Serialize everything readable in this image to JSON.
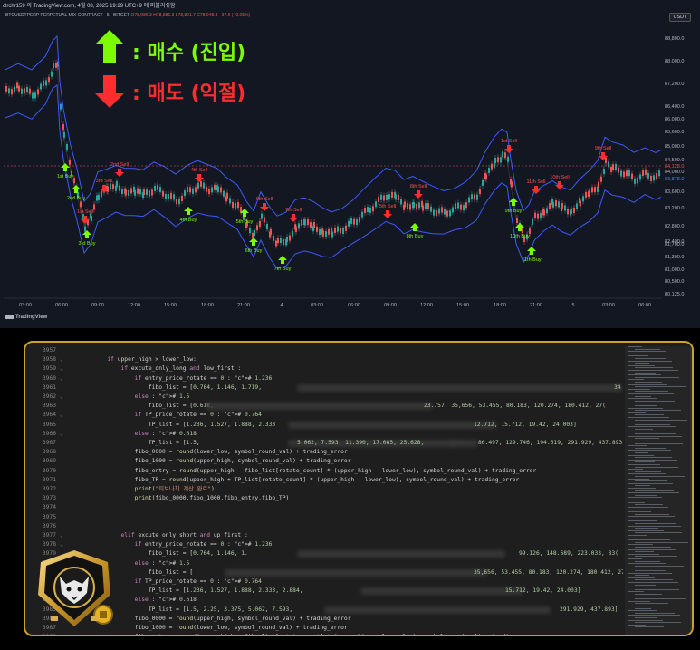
{
  "tv": {
    "header": "clrchr159 의 TradingView.com, 4월 08, 2025 19:29 UTC+9 에 퍼블리쉬함",
    "title": "BTCUSDTPERP PERPETUAL MIX CONTRACT · 5 · BITGET",
    "ohlc": "O78,986.3 H78,986.3 L78,891.7 C78,948.3 −37.9 (−0.05%)",
    "currency": "USDT",
    "legend_buy": ": 매수 (진입)",
    "legend_sell": ": 매도 (익절)",
    "footer": "TradingView",
    "colors": {
      "buy": "#7cfc00",
      "sell": "#ff2d2d",
      "band": "#3d5afe",
      "bg": "#131722"
    },
    "y_ticks": [
      "88,800.0",
      "88,000.0",
      "87,200.0",
      "86,400.0",
      "86,000.0",
      "85,600.0",
      "85,000.0",
      "84,500.0",
      "84,128.0",
      "84,000.0",
      "83,878.0",
      "83,600.0",
      "83,200.0",
      "82,800.0",
      "82,400.0",
      "81,700.0",
      "81,300.0",
      "81,000.0",
      "80,500.0",
      "80,125.0"
    ],
    "x_ticks": [
      "03:00",
      "06:00",
      "09:00",
      "12:00",
      "15:00",
      "18:00",
      "21:00",
      "4",
      "03:00",
      "06:00",
      "09:00",
      "12:00",
      "15:00",
      "18:00",
      "21:00",
      "5",
      "03:00",
      "06:00"
    ],
    "signals": [
      {
        "type": "buy",
        "label": "1st Buy"
      },
      {
        "type": "buy",
        "label": "2nd Buy"
      },
      {
        "type": "sell",
        "label": "1st Sell"
      },
      {
        "type": "buy",
        "label": "3rd Buy"
      },
      {
        "type": "sell",
        "label": "2nd Sell"
      },
      {
        "type": "sell",
        "label": "3rd Sell"
      },
      {
        "type": "sell",
        "label": "4th Sell"
      },
      {
        "type": "buy",
        "label": "4th Buy"
      },
      {
        "type": "buy",
        "label": "5th Buy"
      },
      {
        "type": "sell",
        "label": "6th Sell"
      },
      {
        "type": "buy",
        "label": "6th Buy"
      },
      {
        "type": "sell",
        "label": "7th Sell"
      },
      {
        "type": "buy",
        "label": "7th Buy"
      },
      {
        "type": "sell",
        "label": "5th Sell"
      },
      {
        "type": "sell",
        "label": "8th Sell"
      },
      {
        "type": "buy",
        "label": "8th Buy"
      },
      {
        "type": "sell",
        "label": "1st Sell"
      },
      {
        "type": "buy",
        "label": "9th Buy"
      },
      {
        "type": "buy",
        "label": "10th Buy"
      },
      {
        "type": "sell",
        "label": "11th Sell"
      },
      {
        "type": "buy",
        "label": "11th Buy"
      },
      {
        "type": "sell",
        "label": "10th Sell"
      },
      {
        "type": "sell",
        "label": "9th Sell"
      }
    ]
  },
  "editor": {
    "lines": [
      {
        "n": "3957",
        "fold": "",
        "code": ""
      },
      {
        "n": "3958",
        "fold": "⌄",
        "code": "        if upper_high > lower_low:"
      },
      {
        "n": "3959",
        "fold": "⌄",
        "code": "            if excute_only_long and low_first :"
      },
      {
        "n": "3960",
        "fold": "⌄",
        "code": "                if entry_price_rotate == 0 : # 1.236"
      },
      {
        "n": "3961",
        "fold": "",
        "code": "                    fibo_list = [0.764, 1.146, 1.719,"
      },
      {
        "n": "3962",
        "fold": "⌄",
        "code": "                else : # 1.5"
      },
      {
        "n": "3963",
        "fold": "",
        "code": "                    fibo_list = [0.618,"
      },
      {
        "n": "3964",
        "fold": "⌄",
        "code": "                if TP_price_rotate == 0 : # 0.764"
      },
      {
        "n": "3965",
        "fold": "",
        "code": "                    TP_list = [1.236, 1.527, 1.888, 2.333"
      },
      {
        "n": "3966",
        "fold": "⌄",
        "code": "                else : # 0.618"
      },
      {
        "n": "3967",
        "fold": "",
        "code": "                    TP_list = [1.5,"
      },
      {
        "n": "3968",
        "fold": "",
        "code": "                fibo_0000 = round(lower_low, symbol_round_val) + trading_error"
      },
      {
        "n": "3969",
        "fold": "",
        "code": "                fibo_1000 = round(upper_high, symbol_round_val) + trading_error"
      },
      {
        "n": "3970",
        "fold": "",
        "code": "                fibo_entry = round(upper_high - fibo_list[rotate_count] * (upper_high - lower_low), symbol_round_val) + trading_error"
      },
      {
        "n": "3971",
        "fold": "",
        "code": "                fibo_TP = round(upper_high + TP_list[rotate_count] * (upper_high - lower_low), symbol_round_val) + trading_error"
      },
      {
        "n": "3972",
        "fold": "",
        "code": "                print(\"피보나치 계산 완료\")"
      },
      {
        "n": "3973",
        "fold": "",
        "code": "                print(fibo_0000,fibo_1000,fibo_entry,fibo_TP)"
      },
      {
        "n": "3974",
        "fold": "",
        "code": ""
      },
      {
        "n": "3975",
        "fold": "",
        "code": ""
      },
      {
        "n": "3976",
        "fold": "",
        "code": ""
      },
      {
        "n": "3977",
        "fold": "⌄",
        "code": "            elif excute_only_short and up_first :"
      },
      {
        "n": "3978",
        "fold": "⌄",
        "code": "                if entry_price_rotate == 0 : # 1.236"
      },
      {
        "n": "3979",
        "fold": "",
        "code": "                    fibo_list = [0.764, 1.146, 1."
      },
      {
        "n": "3980",
        "fold": "⌄",
        "code": "                else : # 1.5"
      },
      {
        "n": "3981",
        "fold": "",
        "code": "                    fibo_list = ["
      },
      {
        "n": "3982",
        "fold": "⌄",
        "code": "                if TP_price_rotate == 0 : # 0.764"
      },
      {
        "n": "3983",
        "fold": "",
        "code": "                    TP_list = [1.236, 1.527, 1.888, 2.333, 2.884,"
      },
      {
        "n": "3984",
        "fold": "⌄",
        "code": "                else : # 0.618"
      },
      {
        "n": "3985",
        "fold": "",
        "code": "                    TP_list = [1.5, 2.25, 3.375, 5.062, 7.593,"
      },
      {
        "n": "3986",
        "fold": "",
        "code": "                fibo_0000 = round(upper_high, symbol_round_val) + trading_error"
      },
      {
        "n": "3987",
        "fold": "",
        "code": "                fibo_1000 = round(lower_low, symbol_round_val) + trading_error"
      },
      {
        "n": "3988",
        "fold": "",
        "code": "                fibo_entry = round(upper_high - fibo_list[rotate_count] * (upper_high - lower_low), symbol_round_val) + trading_error"
      }
    ],
    "tails": [
      {
        "line": 4,
        "text": "34"
      },
      {
        "line": 6,
        "text": "23.757, 35,656, 53.455, 80.183, 120.274, 180.412, 27("
      },
      {
        "line": 8,
        "text": "12.712, 15.712, 19.42, 24.003]"
      },
      {
        "line": 10,
        "text": "5.062, 7.593, 11.390, 17.085, 25.628,"
      },
      {
        "line": 10,
        "text2": "86.497, 129.746, 194.619, 291.929, 437.893]"
      },
      {
        "line": 22,
        "text": "99.126, 148.689, 223.033, 33("
      },
      {
        "line": 24,
        "text": "35,656, 53.455, 80.183, 120.274, 180.412, 27("
      },
      {
        "line": 26,
        "text": "15.712, 19.42, 24.003]"
      },
      {
        "line": 28,
        "text": "291.929, 437.893]"
      }
    ]
  }
}
